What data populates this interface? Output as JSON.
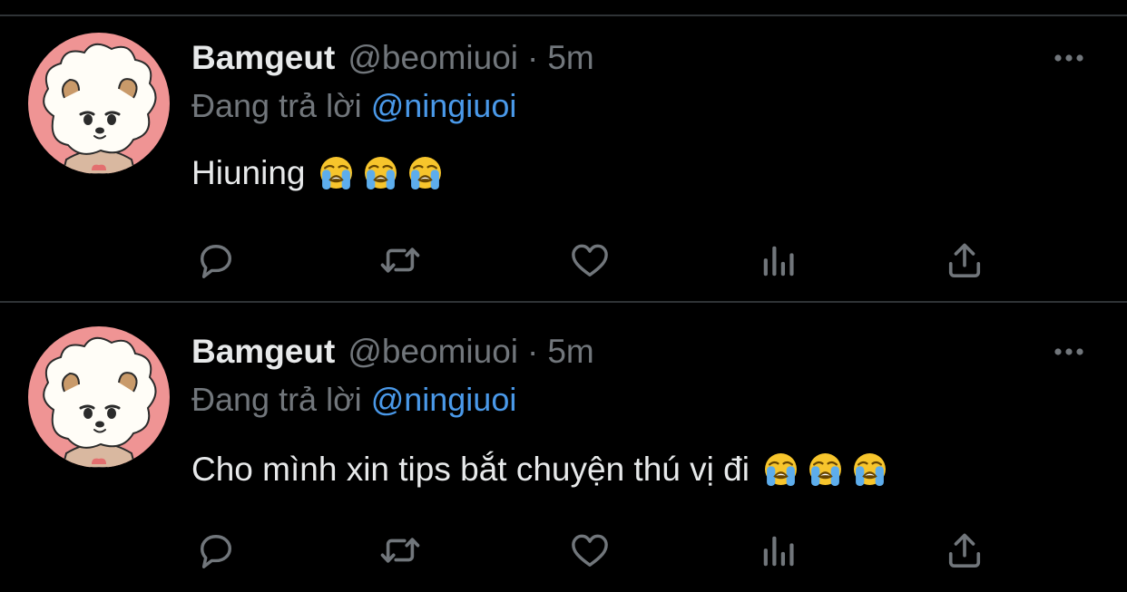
{
  "colors": {
    "background": "#000000",
    "divider": "#2f3336",
    "primary_text": "#e7e9ea",
    "secondary_text": "#71767b",
    "mention": "#4a99e9",
    "avatar_bg": "#ef9494"
  },
  "tweets": [
    {
      "display_name": "Bamgeut",
      "handle": "@beomiuoi",
      "separator": "·",
      "time": "5m",
      "replying_prefix": "Đang trả lời",
      "replying_to": "@ningiuoi",
      "text": "Hiuning",
      "emojis": [
        "loudly-crying-face",
        "loudly-crying-face",
        "loudly-crying-face"
      ],
      "actions": [
        "reply-icon",
        "retweet-icon",
        "like-icon",
        "views-icon",
        "share-icon"
      ]
    },
    {
      "display_name": "Bamgeut",
      "handle": "@beomiuoi",
      "separator": "·",
      "time": "5m",
      "replying_prefix": "Đang trả lời",
      "replying_to": "@ningiuoi",
      "text": "Cho mình xin tips bắt chuyện thú vị đi",
      "emojis": [
        "loudly-crying-face",
        "loudly-crying-face",
        "loudly-crying-face"
      ],
      "actions": [
        "reply-icon",
        "retweet-icon",
        "like-icon",
        "views-icon",
        "share-icon"
      ]
    }
  ]
}
